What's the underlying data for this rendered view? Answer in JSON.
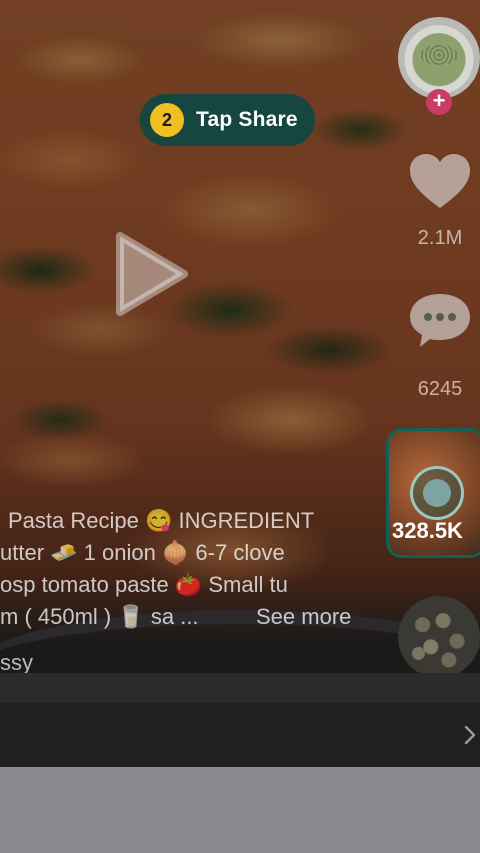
{
  "tip": {
    "step": "2",
    "label": "Tap Share"
  },
  "rail": {
    "likes": "2.1M",
    "comments": "6245",
    "thumb_count": "328.5K"
  },
  "caption": {
    "line1": "Pasta Recipe 😋 INGREDIENT",
    "line2": "utter 🧈 1 onion 🧅  6-7 clove",
    "line3": "osp tomato paste 🍅  Small tu",
    "line4": "m ( 450ml ) 🥛  sa ...",
    "see_more": "See more",
    "handle": "ssy"
  },
  "icons": [
    "play-icon",
    "heart-icon",
    "comment-icon",
    "plus-icon",
    "chevron-right-icon"
  ],
  "colors": {
    "tip_bg": "#16463f",
    "step_badge": "#f1bf22",
    "follow": "#c83d63",
    "highlight_border": "#126156"
  }
}
